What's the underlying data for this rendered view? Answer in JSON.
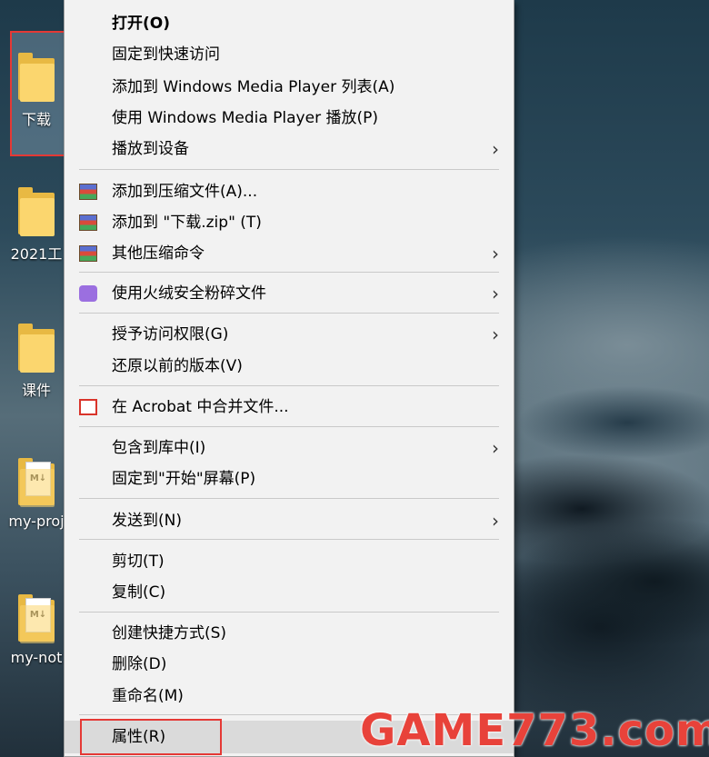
{
  "desktop": {
    "icons": [
      {
        "label": "下载"
      },
      {
        "label": "2021工"
      },
      {
        "label": "课件"
      },
      {
        "label": "my-proj"
      },
      {
        "label": "my-not"
      }
    ],
    "paper_marks": [
      "M↓",
      "M↓"
    ]
  },
  "context_menu": {
    "items": [
      {
        "label": "打开(O)"
      },
      {
        "label": "固定到快速访问"
      },
      {
        "label": "添加到 Windows Media Player 列表(A)"
      },
      {
        "label": "使用 Windows Media Player 播放(P)"
      },
      {
        "label": "播放到设备"
      },
      {
        "label": "添加到压缩文件(A)..."
      },
      {
        "label": "添加到 \"下载.zip\" (T)"
      },
      {
        "label": "其他压缩命令"
      },
      {
        "label": "使用火绒安全粉碎文件"
      },
      {
        "label": "授予访问权限(G)"
      },
      {
        "label": "还原以前的版本(V)"
      },
      {
        "label": "在 Acrobat 中合并文件..."
      },
      {
        "label": "包含到库中(I)"
      },
      {
        "label": "固定到\"开始\"屏幕(P)"
      },
      {
        "label": "发送到(N)"
      },
      {
        "label": "剪切(T)"
      },
      {
        "label": "复制(C)"
      },
      {
        "label": "创建快捷方式(S)"
      },
      {
        "label": "删除(D)"
      },
      {
        "label": "重命名(M)"
      },
      {
        "label": "属性(R)"
      }
    ],
    "submenu_arrow": "›"
  },
  "watermark": {
    "text": "GAME773.com"
  },
  "colors": {
    "highlight_box": "#e53935",
    "watermark": "#e8423a",
    "menu_bg": "#f2f2f2"
  }
}
